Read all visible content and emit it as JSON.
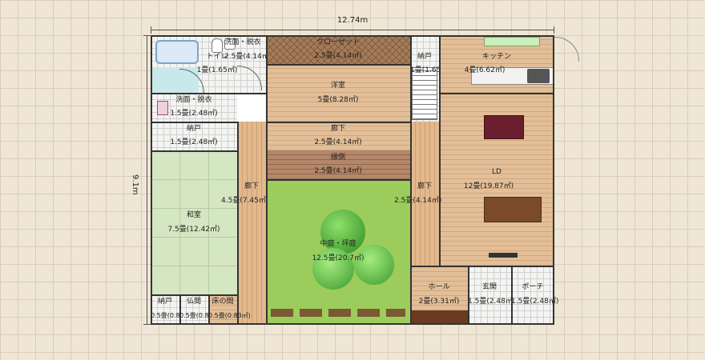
{
  "dimensions": {
    "width": "12.74m",
    "height": "9.1m"
  },
  "rooms": {
    "senmen1": {
      "name": "洗面・脱衣",
      "size": "2.5畳(4.14㎡)"
    },
    "toilet": {
      "name": "トイレ",
      "size": "1畳(1.65㎡)"
    },
    "closet": {
      "name": "クローゼット",
      "size": "2.5畳(4.14㎡)"
    },
    "nando_top": {
      "name": "納戸",
      "size": "1畳(1.65㎡)"
    },
    "kitchen": {
      "name": "キッチン",
      "size": "4畳(6.62㎡)"
    },
    "yoshitsu": {
      "name": "洋室",
      "size": "5畳(8.28㎡)"
    },
    "senmen2": {
      "name": "洗面・脱衣",
      "size": "1.5畳(2.48㎡)"
    },
    "nando_left": {
      "name": "納戸",
      "size": "1.5畳(2.48㎡)"
    },
    "rouka_mid": {
      "name": "廊下",
      "size": "2.5畳(4.14㎡)"
    },
    "engawa": {
      "name": "縁側",
      "size": "2.5畳(4.14㎡)"
    },
    "ld": {
      "name": "LD",
      "size": "12畳(19.87㎡)"
    },
    "rouka_left": {
      "name": "廊下",
      "size": "4.5畳(7.45㎡)"
    },
    "rouka_right": {
      "name": "廊下",
      "size": "2.5畳(4.14㎡)"
    },
    "washitsu": {
      "name": "和室",
      "size": "7.5畳(12.42㎡)"
    },
    "nakaniwa": {
      "name": "中庭・坪庭",
      "size": "12.5畳(20.7㎡)"
    },
    "hall": {
      "name": "ホール",
      "size": "2畳(3.31㎡)"
    },
    "genkan": {
      "name": "玄関",
      "size": "1.5畳(2.48㎡)"
    },
    "porch": {
      "name": "ポーチ",
      "size": "1.5畳(2.48㎡)"
    },
    "nando_bottom": {
      "name": "納戸",
      "size": "0.5畳(0.83㎡)"
    },
    "butsuma": {
      "name": "仏間",
      "size": "0.5畳(0.83㎡)"
    },
    "tokonoma": {
      "name": "床の間",
      "size": "0.5畳(0.83㎡)"
    }
  }
}
